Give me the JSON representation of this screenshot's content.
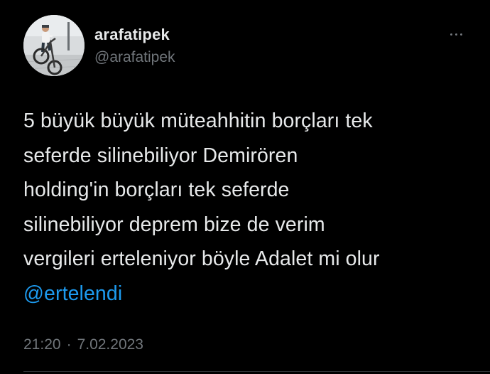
{
  "user": {
    "display_name": "arafatipek",
    "handle": "@arafatipek"
  },
  "actions": {
    "more_icon": "more-horizontal-icon"
  },
  "tweet": {
    "lines": [
      "5 büyük büyük müteahhitin borçları tek",
      "seferde silinebiliyor Demirören",
      "holding'in borçları tek seferde",
      "silinebiliyor deprem bize de verim",
      "vergileri erteleniyor böyle Adalet mi olur"
    ],
    "mention": "@ertelendi",
    "time": "21:20",
    "separator": "·",
    "date": "7.02.2023"
  },
  "colors": {
    "background": "#000000",
    "text": "#e7e9ea",
    "secondary": "#71767b",
    "link": "#1d9bf0",
    "divider": "#2f3336"
  }
}
